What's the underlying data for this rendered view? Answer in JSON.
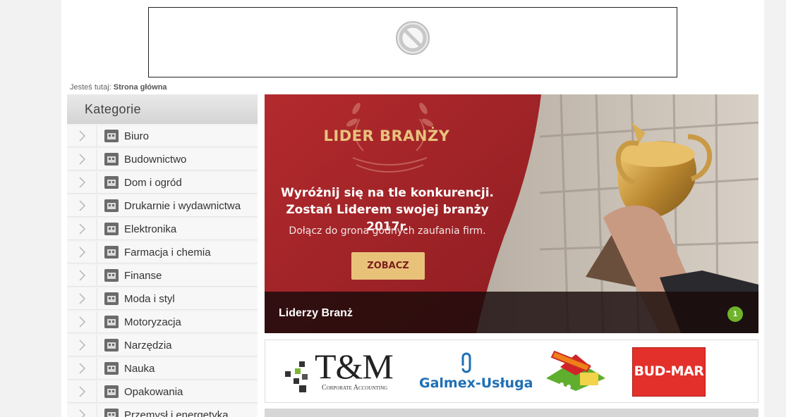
{
  "breadcrumb": {
    "prefix": "Jesteś tutaj:",
    "current": "Strona główna"
  },
  "sidebar": {
    "title": "Kategorie",
    "items": [
      {
        "label": "Biuro",
        "icon": "office-icon"
      },
      {
        "label": "Budownictwo",
        "icon": "building-icon"
      },
      {
        "label": "Dom i ogród",
        "icon": "house-icon"
      },
      {
        "label": "Drukarnie i wydawnictwa",
        "icon": "printer-icon"
      },
      {
        "label": "Elektronika",
        "icon": "monitor-icon"
      },
      {
        "label": "Farmacja i chemia",
        "icon": "pharmacy-icon"
      },
      {
        "label": "Finanse",
        "icon": "chart-icon"
      },
      {
        "label": "Moda i styl",
        "icon": "clothing-icon"
      },
      {
        "label": "Motoryzacja",
        "icon": "car-icon"
      },
      {
        "label": "Narzędzia",
        "icon": "tools-icon"
      },
      {
        "label": "Nauka",
        "icon": "graduation-cap-icon"
      },
      {
        "label": "Opakowania",
        "icon": "package-icon"
      },
      {
        "label": "Przemysł i energetyka",
        "icon": "factory-icon"
      }
    ]
  },
  "banner": {
    "badge": "LIDER BRANŻY",
    "headline_1": "Wyróżnij się na tle konkurencji.",
    "headline_2": "Zostań Liderem swojej branży 2017r.",
    "subtext": "Dołącz do grona godnych zaufania firm.",
    "cta": "ZOBACZ",
    "caption": "Liderzy Branż",
    "slide_number": "1",
    "colors": {
      "red": "#a3262a",
      "gold": "#e9c27a",
      "indicator": "#6fb42c"
    }
  },
  "logos": {
    "tm_name": "T&M",
    "tm_sub": "Corporate Accounting",
    "galmex": "Galmex-Usługa",
    "budmar": "BUD-MAR"
  }
}
